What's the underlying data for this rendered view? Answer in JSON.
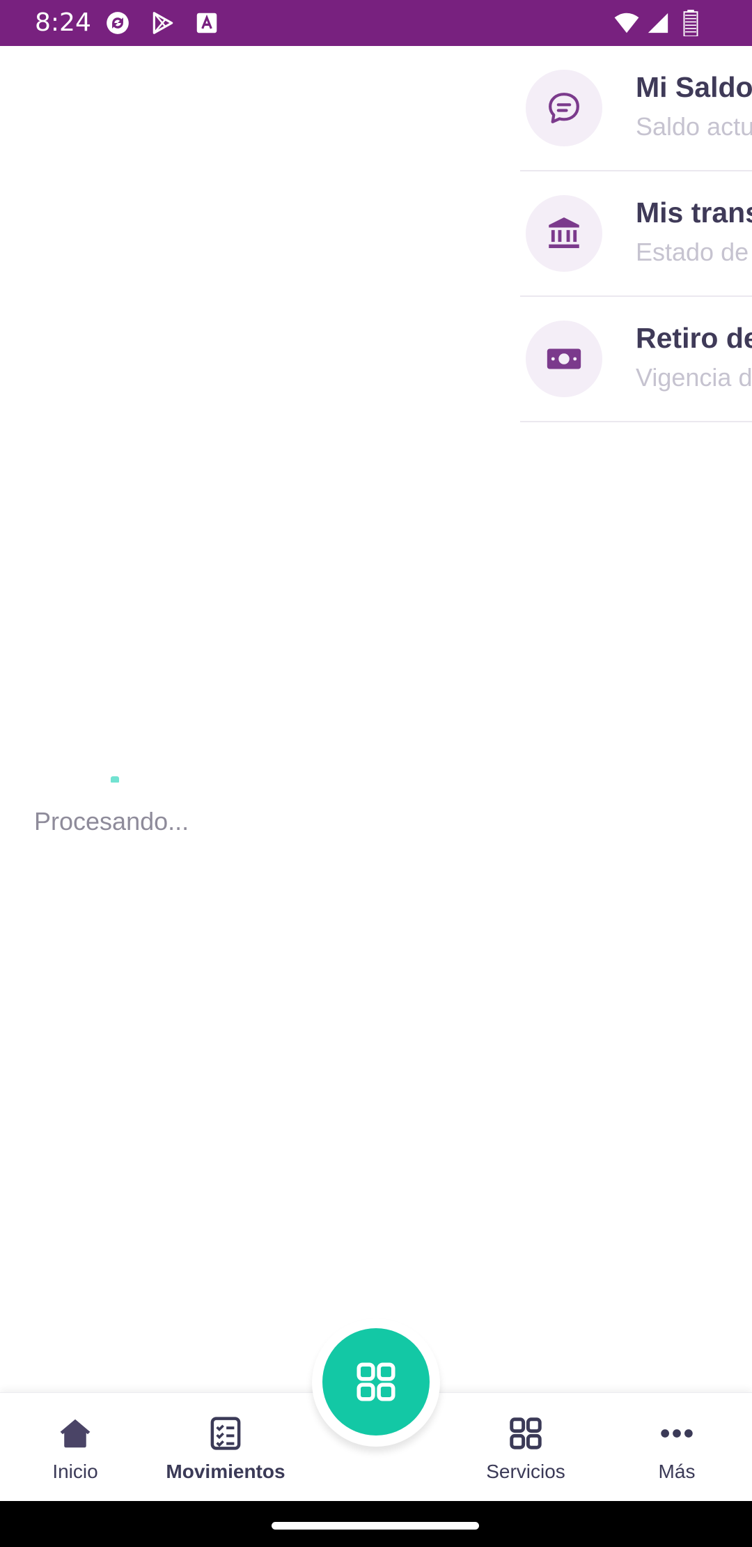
{
  "status_bar": {
    "time": "8:24",
    "background": "#78217f",
    "left_icons": [
      "sync-app-icon",
      "play-store-icon",
      "font-app-icon"
    ],
    "right_icons": [
      "wifi-icon",
      "signal-icon",
      "battery-icon"
    ]
  },
  "list": {
    "items": [
      {
        "icon": "chat-bubble-icon",
        "title": "Mi Saldo",
        "subtitle": "Saldo actual"
      },
      {
        "icon": "bank-icon",
        "title": "Mis transferencias",
        "subtitle": "Estado de transferencias"
      },
      {
        "icon": "cash-icon",
        "title": "Retiro de efectivo",
        "subtitle": "Vigencia del retiro"
      }
    ]
  },
  "loader": {
    "label": "Procesando..."
  },
  "bottom_nav": {
    "items": [
      {
        "icon": "home-icon",
        "label": "Inicio",
        "active": false
      },
      {
        "icon": "checklist-icon",
        "label": "Movimientos",
        "active": true
      },
      {
        "icon": "grid-icon",
        "label": "Servicios",
        "active": false
      },
      {
        "icon": "more-icon",
        "label": "Más",
        "active": false
      }
    ],
    "fab_icon": "qr-grid-icon"
  },
  "colors": {
    "accent": "#13c8a5",
    "brand": "#78217f",
    "icon_purple": "#7b3a8c",
    "text_dark": "#3f3a58"
  }
}
